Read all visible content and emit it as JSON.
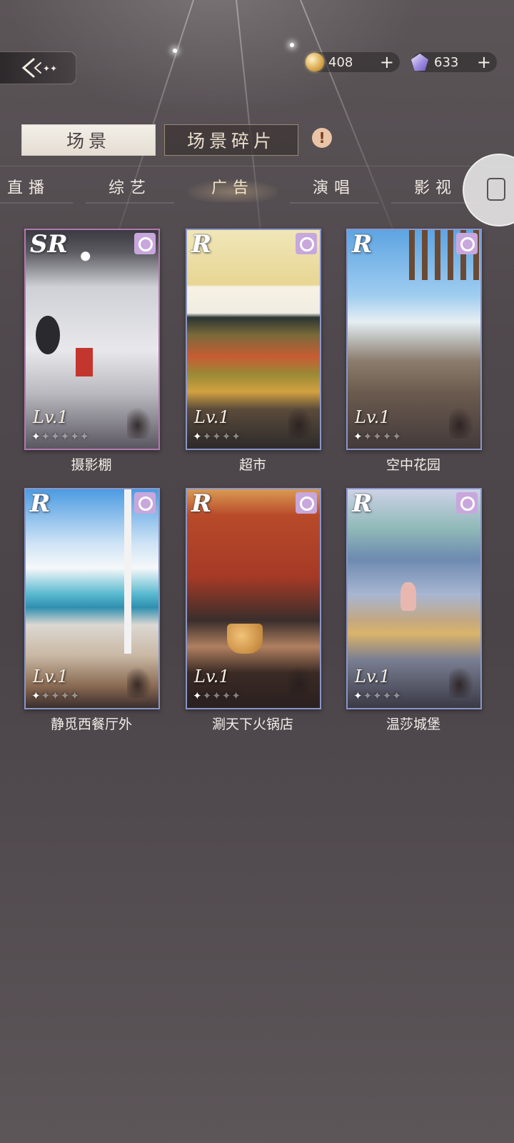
{
  "currency": {
    "coins": "408",
    "gems": "633",
    "add_symbol": "+"
  },
  "tabs": {
    "scene": "场景",
    "fragments": "场景碎片",
    "alert_symbol": "!"
  },
  "categories": [
    "直播",
    "综艺",
    "广告",
    "演唱",
    "影视"
  ],
  "active_category": "广告",
  "cards": [
    {
      "rarity": "SR",
      "level": "Lv.1",
      "name": "摄影棚",
      "stars_filled": 1,
      "stars_total": 6
    },
    {
      "rarity": "R",
      "level": "Lv.1",
      "name": "超市",
      "stars_filled": 1,
      "stars_total": 5
    },
    {
      "rarity": "R",
      "level": "Lv.1",
      "name": "空中花园",
      "stars_filled": 1,
      "stars_total": 5
    },
    {
      "rarity": "R",
      "level": "Lv.1",
      "name": "静觅西餐厅外",
      "stars_filled": 1,
      "stars_total": 5
    },
    {
      "rarity": "R",
      "level": "Lv.1",
      "name": "涮天下火锅店",
      "stars_filled": 1,
      "stars_total": 5
    },
    {
      "rarity": "R",
      "level": "Lv.1",
      "name": "温莎城堡",
      "stars_filled": 1,
      "stars_total": 5
    }
  ],
  "colors": {
    "sr_border": "#b27ab0",
    "r_border": "#8a96c8",
    "badge": "#c8a7dd"
  }
}
